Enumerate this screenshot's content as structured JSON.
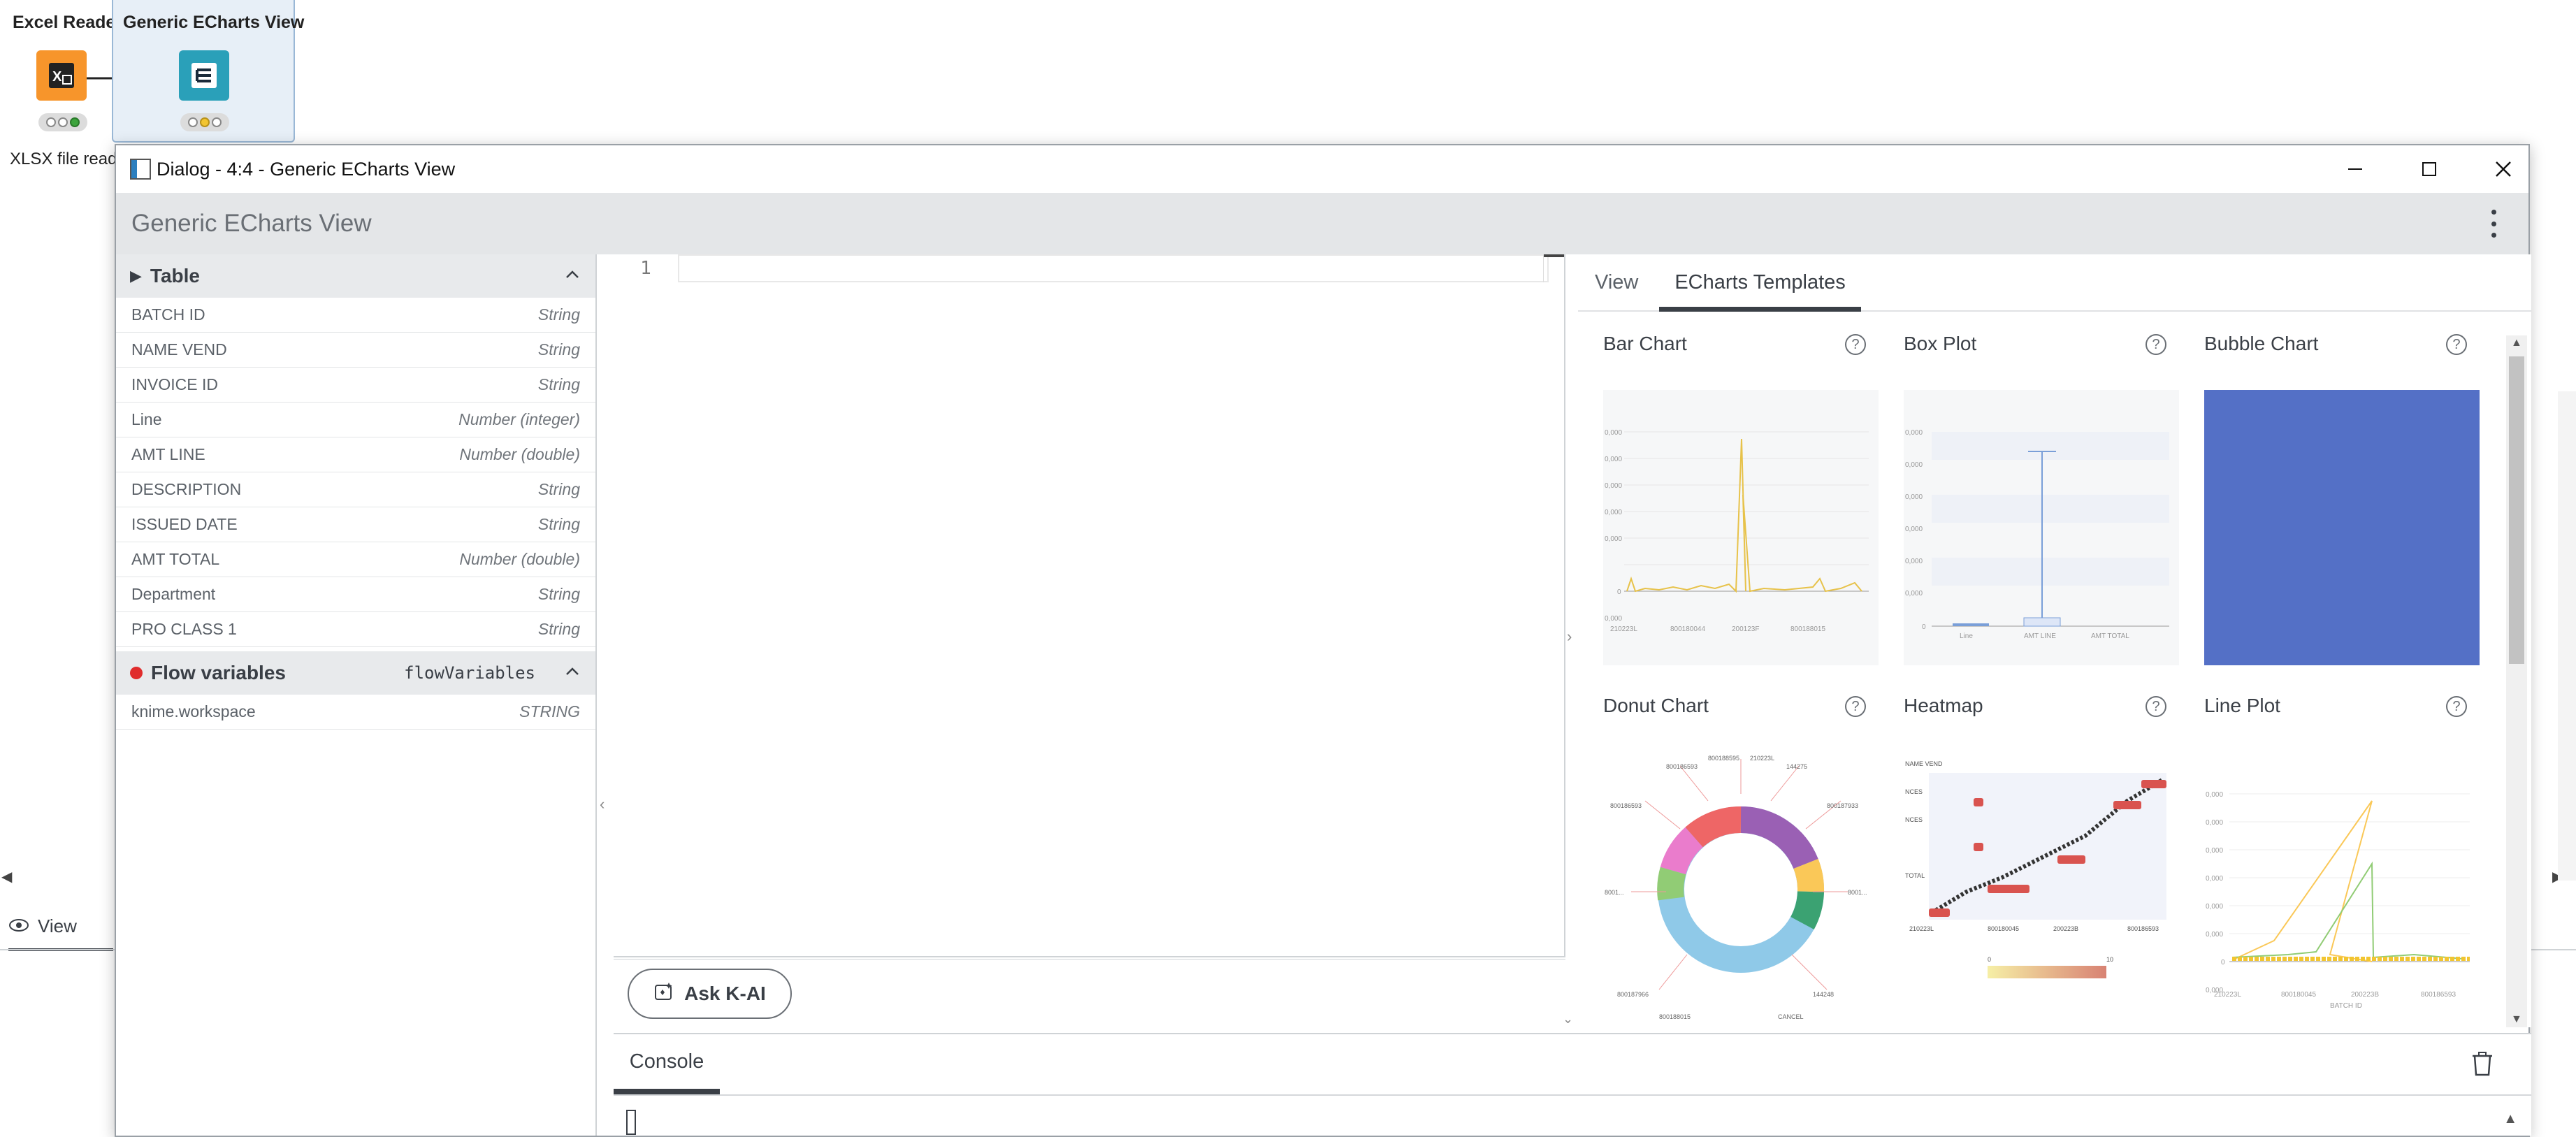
{
  "workflow": {
    "nodes": [
      {
        "title": "Excel Reader",
        "description": "XLSX file read",
        "color": "#f7952b"
      },
      {
        "title": "Generic ECharts View",
        "color": "#2aa0b9"
      }
    ],
    "view_tab_label": "View"
  },
  "dialog": {
    "window_title": "Dialog - 4:4 - Generic ECharts View",
    "app_title": "Generic ECharts View"
  },
  "table": {
    "title": "Table",
    "columns": [
      {
        "name": "BATCH ID",
        "type": "String"
      },
      {
        "name": "NAME VEND",
        "type": "String"
      },
      {
        "name": "INVOICE ID",
        "type": "String"
      },
      {
        "name": "Line",
        "type": "Number (integer)"
      },
      {
        "name": "AMT LINE",
        "type": "Number (double)"
      },
      {
        "name": "DESCRIPTION",
        "type": "String"
      },
      {
        "name": "ISSUED DATE",
        "type": "String"
      },
      {
        "name": "AMT TOTAL",
        "type": "Number (double)"
      },
      {
        "name": "Department",
        "type": "String"
      },
      {
        "name": "PRO CLASS 1",
        "type": "String"
      }
    ]
  },
  "flow_variables": {
    "title": "Flow variables",
    "code_name": "flowVariables",
    "items": [
      {
        "name": "knime.workspace",
        "type": "STRING"
      }
    ]
  },
  "editor": {
    "line_number": "1",
    "ask_button_label": "Ask K-AI"
  },
  "right_panel": {
    "tabs": [
      {
        "label": "View",
        "active": false
      },
      {
        "label": "ECharts Templates",
        "active": true
      }
    ],
    "templates": [
      {
        "title": "Bar Chart"
      },
      {
        "title": "Box Plot"
      },
      {
        "title": "Bubble Chart"
      },
      {
        "title": "Donut Chart"
      },
      {
        "title": "Heatmap"
      },
      {
        "title": "Line Plot"
      }
    ],
    "help_glyph": "?"
  },
  "console": {
    "label": "Console"
  },
  "colors": {
    "accent": "#3a3f46",
    "excel_node": "#f7952b",
    "echarts_node": "#2aa0b9",
    "bubble_fill": "#5470c6",
    "flow_dot": "#e02c2c"
  }
}
